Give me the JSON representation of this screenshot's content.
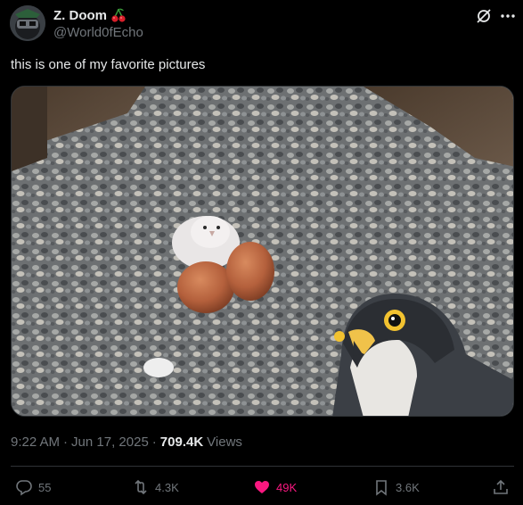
{
  "author": {
    "display_name": "Z. Doom",
    "handle": "@World0fEcho",
    "badge_icon": "cherry-icon"
  },
  "header_icons": [
    "grok-icon",
    "more-icon"
  ],
  "tweet": {
    "text": "this is one of my favorite pictures"
  },
  "meta": {
    "time": "9:22 AM",
    "separator": "·",
    "date": "Jun 17, 2025",
    "separator2": "·",
    "views_count": "709.4K",
    "views_label": "Views"
  },
  "actions": {
    "replies": "55",
    "reposts": "4.3K",
    "likes": "49K",
    "bookmarks": "3.6K"
  },
  "colors": {
    "background": "#000000",
    "text": "#e7e9ea",
    "muted": "#71767b",
    "like": "#f91880",
    "divider": "#2f3336"
  }
}
